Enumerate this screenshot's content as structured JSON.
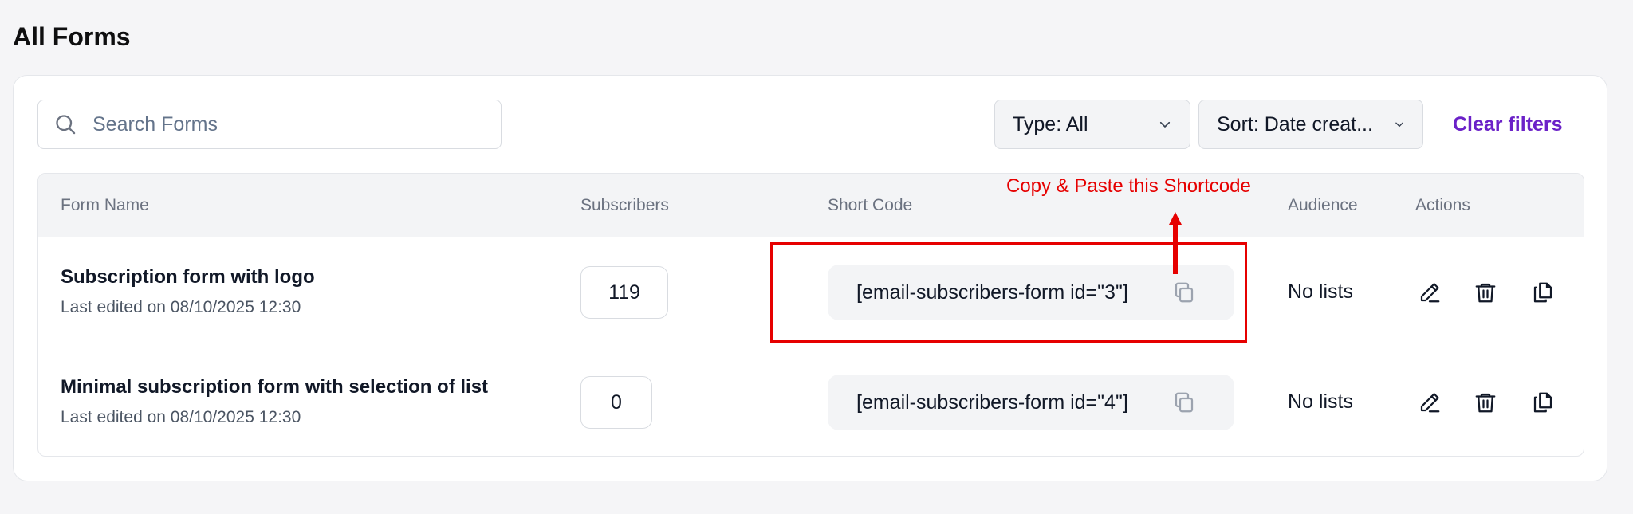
{
  "page": {
    "title": "All Forms"
  },
  "search": {
    "placeholder": "Search Forms",
    "icon": "search-icon"
  },
  "filters": {
    "type_label": "Type: All",
    "sort_label": "Sort: Date creat...",
    "clear_label": "Clear filters",
    "accent_color": "#6b21c8"
  },
  "table": {
    "columns": [
      "Form Name",
      "Subscribers",
      "Short Code",
      "Audience",
      "Actions"
    ],
    "rows": [
      {
        "name": "Subscription form with logo",
        "edited": "Last edited on 08/10/2025 12:30",
        "subscribers": "119",
        "shortcode": "[email-subscribers-form id=\"3\"]",
        "audience": "No lists"
      },
      {
        "name": "Minimal subscription form with selection of list",
        "edited": "Last edited on 08/10/2025 12:30",
        "subscribers": "0",
        "shortcode": "[email-subscribers-form id=\"4\"]",
        "audience": "No lists"
      }
    ]
  },
  "annotation": {
    "text": "Copy & Paste this Shortcode",
    "color": "#e60000"
  }
}
